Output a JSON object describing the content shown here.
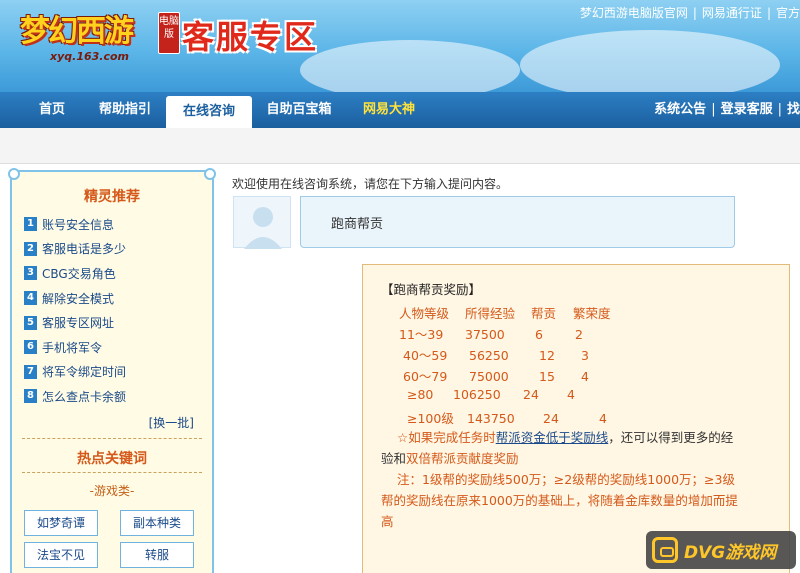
{
  "header": {
    "logo_text": "梦幻西游",
    "logo_badge": "电脑版",
    "logo_url": "xyq.163.com",
    "site_title": "客服专区",
    "top_links": [
      "梦幻西游电脑版官网",
      "网易通行证",
      "官方"
    ]
  },
  "nav": {
    "items": [
      "首页",
      "帮助指引",
      "在线咨询",
      "自助百宝箱",
      "网易大神"
    ],
    "active": "在线咨询",
    "right_links": [
      "系统公告",
      "登录客服",
      "找"
    ]
  },
  "sidebar": {
    "rec_title": "精灵推荐",
    "rec_items": [
      {
        "num": "1",
        "label": "账号安全信息"
      },
      {
        "num": "2",
        "label": "客服电话是多少"
      },
      {
        "num": "3",
        "label": "CBG交易角色"
      },
      {
        "num": "4",
        "label": "解除安全模式"
      },
      {
        "num": "5",
        "label": "客服专区网址"
      },
      {
        "num": "6",
        "label": "手机将军令"
      },
      {
        "num": "7",
        "label": "将军令绑定时间"
      },
      {
        "num": "8",
        "label": "怎么查点卡余额"
      }
    ],
    "refresh": "[换一批]",
    "hot_title": "热点关键词",
    "category": "-游戏类-",
    "keywords": [
      "如梦奇谭",
      "副本种类",
      "法宝不见",
      "转服"
    ]
  },
  "main": {
    "welcome": "欢迎使用在线咨询系统，请您在下方输入提问内容。",
    "user_question": "跑商帮贡",
    "answer": {
      "title": "【跑商帮贡奖励】",
      "table_header": [
        "人物等级",
        "所得经验",
        "帮贡",
        "繁荣度"
      ],
      "table_rows": [
        [
          "11～39",
          "37500",
          "6",
          "2"
        ],
        [
          "40～59",
          "56250",
          "12",
          "3"
        ],
        [
          "60～79",
          "75000",
          "15",
          "4"
        ],
        [
          "≥80",
          "106250",
          "24",
          "4"
        ],
        [
          "≥100级",
          "143750",
          "24",
          "4"
        ]
      ],
      "tip_prefix": "☆如果完成任务时",
      "tip_link": "帮派资金低于奖励线",
      "tip_mid": "，还可以得到更多的经",
      "tip_line2_a": "验和",
      "tip_line2_b": "双倍帮派贡献度奖励",
      "note_lines": [
        "注：1级帮的奖励线500万；≥2级帮的奖励线1000万；≥3级",
        "帮的奖励线在原来1000万的基础上，将随着金库数量的增加而提",
        "高"
      ]
    }
  },
  "watermark": "DVG游戏网",
  "colors": {
    "nav_bg": "#1b5f9f",
    "accent_orange": "#d4591a",
    "link_blue": "#1a4a8a",
    "sidebar_border": "#7fc3e8"
  }
}
